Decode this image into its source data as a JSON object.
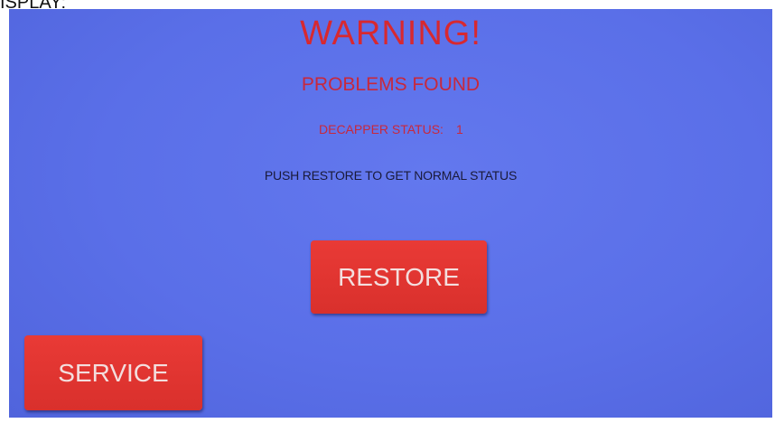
{
  "caption": {
    "text": "ISPLAY:"
  },
  "screen": {
    "title": "WARNING!",
    "subtitle": "PROBLEMS FOUND",
    "status": {
      "label": "DECAPPER STATUS:",
      "value": "1"
    },
    "instruction": "PUSH RESTORE TO GET NORMAL STATUS",
    "buttons": {
      "restore": "RESTORE",
      "service": "SERVICE"
    }
  },
  "colors": {
    "background": "#5a6fe8",
    "text_red": "#c8283c",
    "button_red": "#e13430"
  }
}
